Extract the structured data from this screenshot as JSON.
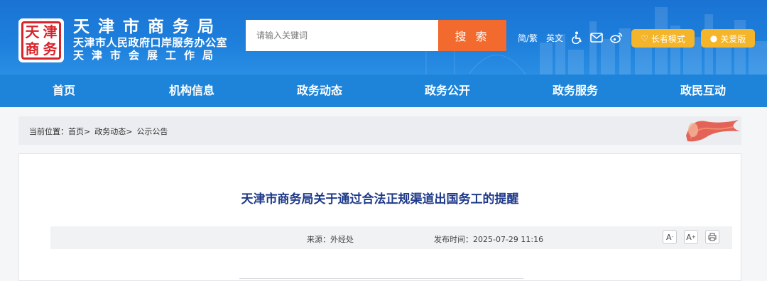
{
  "header": {
    "seal_chars": [
      "天",
      "津",
      "商",
      "务"
    ],
    "title_line1": "天津市商务局",
    "title_line2": "天津市人民政府口岸服务办公室",
    "title_line3": "天津市会展工作局",
    "search_placeholder": "请输入关键词",
    "search_button": "搜 索",
    "tools": {
      "simplified_traditional": "简/繁",
      "english": "英文",
      "accessibility_icon": "wheelchair-icon",
      "mail_icon": "mail-icon",
      "weibo_icon": "weibo-icon"
    },
    "elder_mode": "长者模式",
    "care_version": "关爱版"
  },
  "nav": {
    "items": [
      "首页",
      "机构信息",
      "政务动态",
      "政务公开",
      "政务服务",
      "政民互动"
    ]
  },
  "breadcrumb": {
    "prefix": "当前位置：",
    "items": [
      "首页>",
      "政务动态>",
      "公示公告"
    ]
  },
  "article": {
    "title": "天津市商务局关于通过合法正规渠道出国务工的提醒",
    "source": "来源：外经处",
    "date": "发布时间：2025-07-29 11:16",
    "font_smaller": "A",
    "font_larger": "A",
    "print_icon": "printer-icon"
  },
  "colors": {
    "header_blue": "#1e80dc",
    "search_orange": "#f26a2d",
    "pill_yellow": "#f4b52a",
    "title_blue": "#1f3a8a"
  }
}
